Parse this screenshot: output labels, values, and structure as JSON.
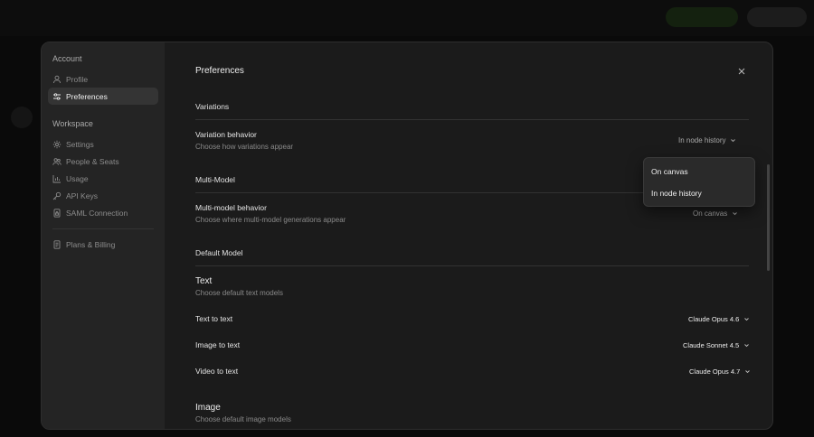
{
  "sidebar": {
    "account_heading": "Account",
    "account_items": [
      {
        "label": "Profile",
        "icon": "user-icon"
      },
      {
        "label": "Preferences",
        "icon": "sliders-icon"
      }
    ],
    "workspace_heading": "Workspace",
    "workspace_items": [
      {
        "label": "Settings",
        "icon": "gear-icon"
      },
      {
        "label": "People & Seats",
        "icon": "people-icon"
      },
      {
        "label": "Usage",
        "icon": "bar-chart-icon"
      },
      {
        "label": "API Keys",
        "icon": "key-icon"
      },
      {
        "label": "SAML Connection",
        "icon": "document-lock-icon"
      }
    ],
    "billing_item": {
      "label": "Plans & Billing",
      "icon": "receipt-icon"
    },
    "active": "Preferences"
  },
  "main": {
    "title": "Preferences",
    "variations": {
      "section": "Variations",
      "label": "Variation behavior",
      "description": "Choose how variations appear",
      "value": "In node history"
    },
    "multi_model": {
      "section": "Multi-Model",
      "label": "Multi-model behavior",
      "description": "Choose where multi-model generations appear",
      "value": "On canvas"
    },
    "default_model": {
      "section": "Default Model",
      "text_group": {
        "title": "Text",
        "description": "Choose default text models",
        "rows": [
          {
            "label": "Text to text",
            "value": "Claude Opus 4.6"
          },
          {
            "label": "Image to text",
            "value": "Claude Sonnet 4.5"
          },
          {
            "label": "Video to text",
            "value": "Claude Opus 4.7"
          }
        ]
      },
      "image_group": {
        "title": "Image",
        "description": "Choose default image models"
      }
    }
  },
  "popup": {
    "options": [
      "On canvas",
      "In node history"
    ]
  }
}
